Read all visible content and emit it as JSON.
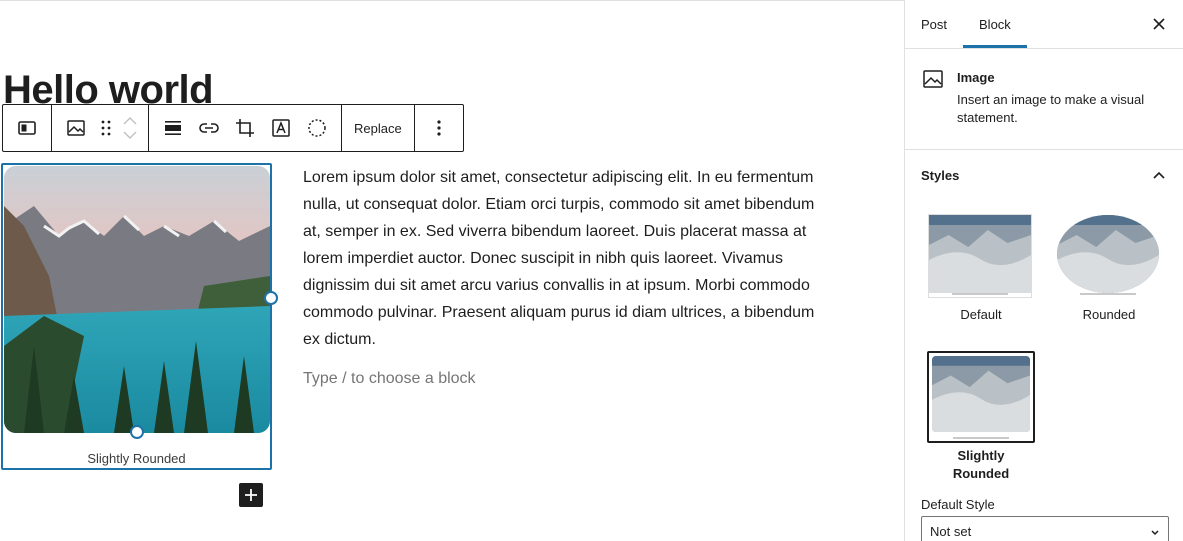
{
  "post": {
    "title": "Hello world",
    "paragraph": "Lorem ipsum dolor sit amet, consectetur adipiscing elit. In eu fermentum nulla, ut consequat dolor. Etiam orci turpis, commodo sit amet bibendum at, semper in ex. Sed viverra bibendum laoreet. Duis placerat massa at lorem imperdiet auctor. Donec suscipit in nibh quis laoreet. Vivamus dignissim dui sit amet arcu varius convallis in at ipsum. Morbi commodo commodo pulvinar. Praesent aliquam purus id diam ultrices, a bibendum ex dictum.",
    "placeholder": "Type / to choose a block",
    "image_caption": "Slightly Rounded"
  },
  "toolbar": {
    "replace_label": "Replace",
    "icons": [
      "block-type-icon",
      "image-icon",
      "drag-handle-icon",
      "move-up-icon",
      "move-down-icon",
      "align-icon",
      "link-icon",
      "crop-icon",
      "text-overlay-icon",
      "duotone-icon",
      "more-options-icon"
    ]
  },
  "sidebar": {
    "tabs": [
      {
        "label": "Post",
        "active": false
      },
      {
        "label": "Block",
        "active": true
      }
    ],
    "block": {
      "name": "Image",
      "description": "Insert an image to make a visual statement."
    },
    "styles": {
      "heading": "Styles",
      "options": [
        {
          "label": "Default",
          "selected": false
        },
        {
          "label": "Rounded",
          "selected": false
        },
        {
          "label": "Slightly Rounded",
          "selected": true
        }
      ]
    },
    "default_style": {
      "label": "Default Style",
      "value": "Not set"
    }
  },
  "colors": {
    "accent": "#1d72aa",
    "text": "#1e1e1e",
    "muted": "#757575"
  }
}
